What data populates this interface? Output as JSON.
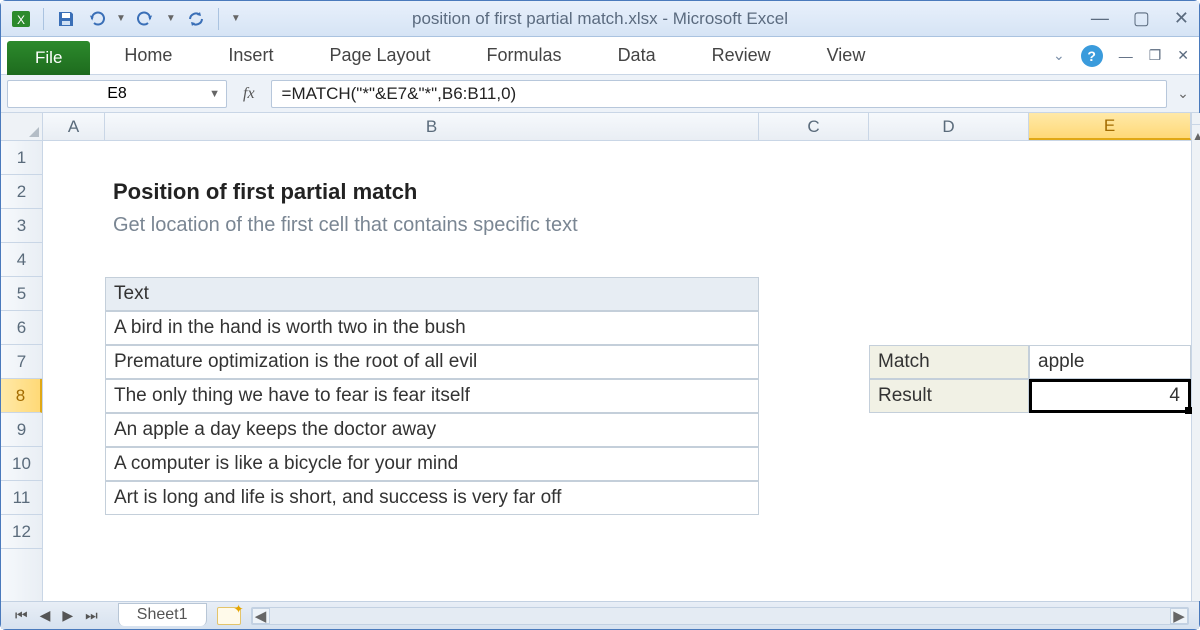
{
  "window": {
    "title": "position of first partial match.xlsx  -  Microsoft Excel"
  },
  "ribbon": {
    "file": "File",
    "tabs": [
      "Home",
      "Insert",
      "Page Layout",
      "Formulas",
      "Data",
      "Review",
      "View"
    ]
  },
  "formula_bar": {
    "name_box": "E8",
    "fx_label": "fx",
    "formula": "=MATCH(\"*\"&E7&\"*\",B6:B11,0)"
  },
  "columns": [
    "A",
    "B",
    "C",
    "D",
    "E"
  ],
  "rows": [
    "1",
    "2",
    "3",
    "4",
    "5",
    "6",
    "7",
    "8",
    "9",
    "10",
    "11",
    "12"
  ],
  "active": {
    "col": "E",
    "row": "8"
  },
  "content": {
    "title": "Position of first partial match",
    "subtitle": "Get location of the first cell that contains specific text",
    "table_header": "Text",
    "texts": [
      "A bird in the hand is worth two in the bush",
      "Premature optimization is the root of all evil",
      "The only thing we have to fear is fear itself",
      "An apple a day keeps the doctor away",
      "A computer is like a bicycle for your mind",
      "Art is long and life is short, and success is very far off"
    ],
    "side": {
      "match_label": "Match",
      "match_value": "apple",
      "result_label": "Result",
      "result_value": "4"
    }
  },
  "sheet_tab": "Sheet1"
}
